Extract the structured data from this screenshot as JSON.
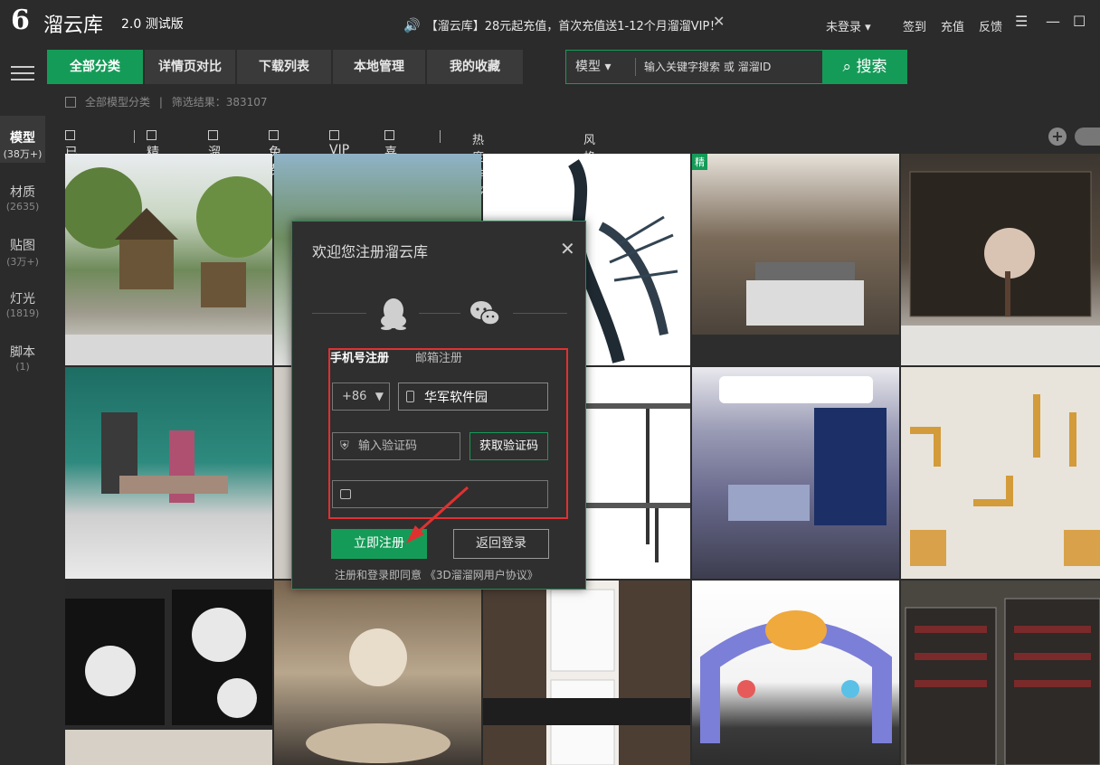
{
  "app": {
    "logo_glyph": "6",
    "name": "溜云库",
    "version": "2.0 测试版"
  },
  "notice": {
    "text": "【溜云库】28元起充值，首次充值送1-12个月溜溜VIP！",
    "close": "✕"
  },
  "titlebar": {
    "login_status": "未登录 ▾",
    "checkin": "签到",
    "recharge": "充值",
    "feedback": "反馈",
    "menu": "☰",
    "minimize": "—",
    "maximize": "☐"
  },
  "sidebar": {
    "items": [
      {
        "label": "模型",
        "count": "(38万+)",
        "active": true
      },
      {
        "label": "材质",
        "count": "(2635)"
      },
      {
        "label": "贴图",
        "count": "(3万+)"
      },
      {
        "label": "灯光",
        "count": "(1819)"
      },
      {
        "label": "脚本",
        "count": "(1)"
      }
    ]
  },
  "nav": {
    "tabs": [
      {
        "label": "全部分类",
        "active": true
      },
      {
        "label": "详情页对比"
      },
      {
        "label": "下载列表"
      },
      {
        "label": "本地管理"
      },
      {
        "label": "我的收藏"
      }
    ]
  },
  "search": {
    "type": "模型 ▾",
    "placeholder": "输入关键字搜索 或 溜溜ID",
    "button": "搜索"
  },
  "breadcrumb": {
    "root": "全部模型分类",
    "result": "筛选结果：383107"
  },
  "filters": {
    "checkboxes": [
      "已下载",
      "精品",
      "溜币",
      "免费",
      "VIP",
      "喜欢"
    ],
    "sort": "热度排序 ▾",
    "style": "风格 ▾"
  },
  "grid": {
    "badge": "精",
    "colors": {
      "accent": "#159b58"
    }
  },
  "dialog": {
    "title": "欢迎您注册溜云库",
    "close": "✕",
    "tab_phone": "手机号注册",
    "tab_email": "邮箱注册",
    "country_code": "+86",
    "phone_value": "华军软件园",
    "code_placeholder": "输入验证码",
    "get_code": "获取验证码",
    "register": "立即注册",
    "back_login": "返回登录",
    "agreement": "注册和登录即同意 《3D溜溜网用户协议》"
  }
}
